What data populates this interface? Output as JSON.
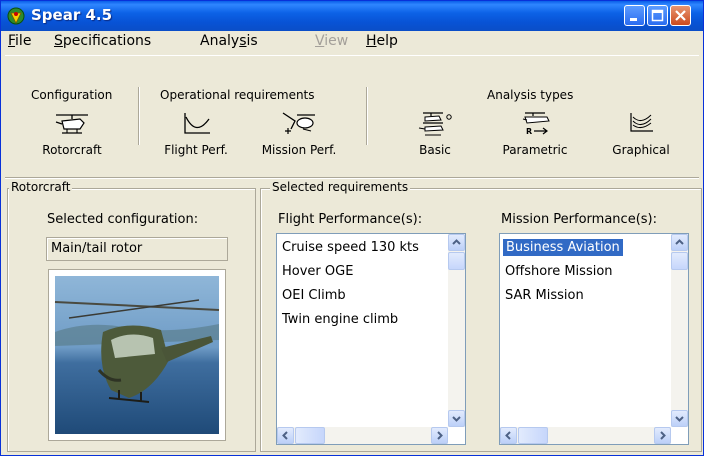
{
  "window": {
    "title": "Spear 4.5"
  },
  "menu": {
    "file": {
      "mnemonic": "F",
      "rest": "ile"
    },
    "specifications": {
      "mnemonic": "S",
      "rest": "pecifications"
    },
    "analysis": {
      "pre": "Analy",
      "mnemonic": "s",
      "rest": "is"
    },
    "view": {
      "mnemonic": "V",
      "rest": "iew"
    },
    "help": {
      "mnemonic": "H",
      "rest": "elp"
    }
  },
  "toolbar": {
    "groups": {
      "configuration": "Configuration",
      "operational": "Operational requirements",
      "analysis_types": "Analysis types"
    },
    "buttons": {
      "rotorcraft": "Rotorcraft",
      "flight_perf": "Flight Perf.",
      "mission_perf": "Mission Perf.",
      "basic": "Basic",
      "parametric": "Parametric",
      "graphical": "Graphical"
    }
  },
  "rotorcraft_panel": {
    "legend": "Rotorcraft",
    "selected_label": "Selected configuration:",
    "selected_value": "Main/tail rotor"
  },
  "requirements_panel": {
    "legend": "Selected requirements",
    "flight": {
      "label": "Flight Performance(s):",
      "items": [
        "Cruise speed 130 kts",
        "Hover OGE",
        "OEI Climb",
        "Twin engine climb"
      ]
    },
    "mission": {
      "label": "Mission Performance(s):",
      "items": [
        "Business Aviation",
        "Offshore Mission",
        "SAR Mission"
      ],
      "selected_index": 0
    }
  },
  "colors": {
    "titlebar": "#0a54d8",
    "selection": "#316ac5",
    "window_bg": "#ece9d8"
  }
}
